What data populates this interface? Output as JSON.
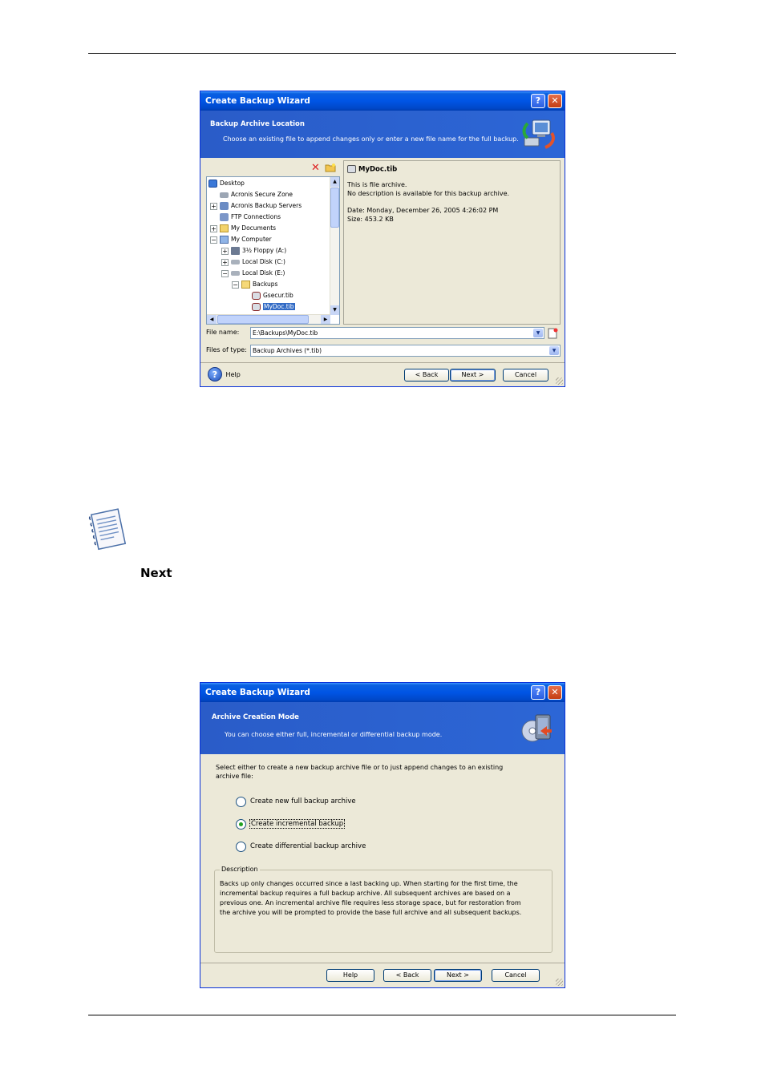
{
  "wizard1": {
    "title": "Create Backup Wizard",
    "banner_title": "Backup Archive Location",
    "banner_subtitle": "Choose an existing file to append changes only or enter a new file name for the full backup.",
    "tree": [
      {
        "label": "Desktop",
        "icon": "desktop-icon"
      },
      {
        "label": "Acronis Secure Zone",
        "icon": "secure-zone-icon"
      },
      {
        "label": "Acronis Backup Servers",
        "icon": "network-icon"
      },
      {
        "label": "FTP Connections",
        "icon": "ftp-icon"
      },
      {
        "label": "My Documents",
        "icon": "folder-icon"
      },
      {
        "label": "My Computer",
        "icon": "computer-icon"
      },
      {
        "label": "3½ Floppy (A:)",
        "icon": "floppy-icon"
      },
      {
        "label": "Local Disk (C:)",
        "icon": "disk-icon"
      },
      {
        "label": "Local Disk (E:)",
        "icon": "disk-icon"
      },
      {
        "label": "Backups",
        "icon": "folder-open-icon"
      },
      {
        "label": "Gsecur.tib",
        "icon": "archive-icon"
      },
      {
        "label": "MyDoc.tib",
        "icon": "archive-icon"
      }
    ],
    "info": {
      "filename": "MyDoc.tib",
      "line1": "This is file archive.",
      "line2": "No description is available for this backup archive.",
      "date": "Date: Monday, December 26, 2005 4:26:02 PM",
      "size": "Size: 453.2 KB"
    },
    "file_name_label": "File name:",
    "file_name_value": "E:\\Backups\\MyDoc.tib",
    "files_of_type_label": "Files of type:",
    "files_of_type_value": "Backup Archives (*.tib)",
    "help_label": "Help",
    "back_label": "< Back",
    "next_label": "Next >",
    "cancel_label": "Cancel"
  },
  "next_word": "Next",
  "wizard2": {
    "title": "Create Backup Wizard",
    "banner_title": "Archive Creation Mode",
    "banner_subtitle": "You can choose either full, incremental or differential backup mode.",
    "prompt_line1": "Select either to create a new backup archive file or to just append changes to an existing",
    "prompt_line2": "archive file:",
    "options": [
      {
        "label": "Create new full backup archive",
        "selected": false
      },
      {
        "label": "Create incremental backup",
        "selected": true
      },
      {
        "label": "Create differential backup archive",
        "selected": false
      }
    ],
    "description_title": "Description",
    "description_lines": [
      "Backs up only changes occurred since a last backing up. When starting for the first time, the",
      "incremental backup requires a full backup archive. All subsequent archives are based on a",
      "previous one. An incremental archive file requires less storage space, but for restoration from",
      "the archive you will be prompted to provide the base full archive and all subsequent backups."
    ],
    "help_label": "Help",
    "back_label": "< Back",
    "next_label": "Next >",
    "cancel_label": "Cancel"
  }
}
